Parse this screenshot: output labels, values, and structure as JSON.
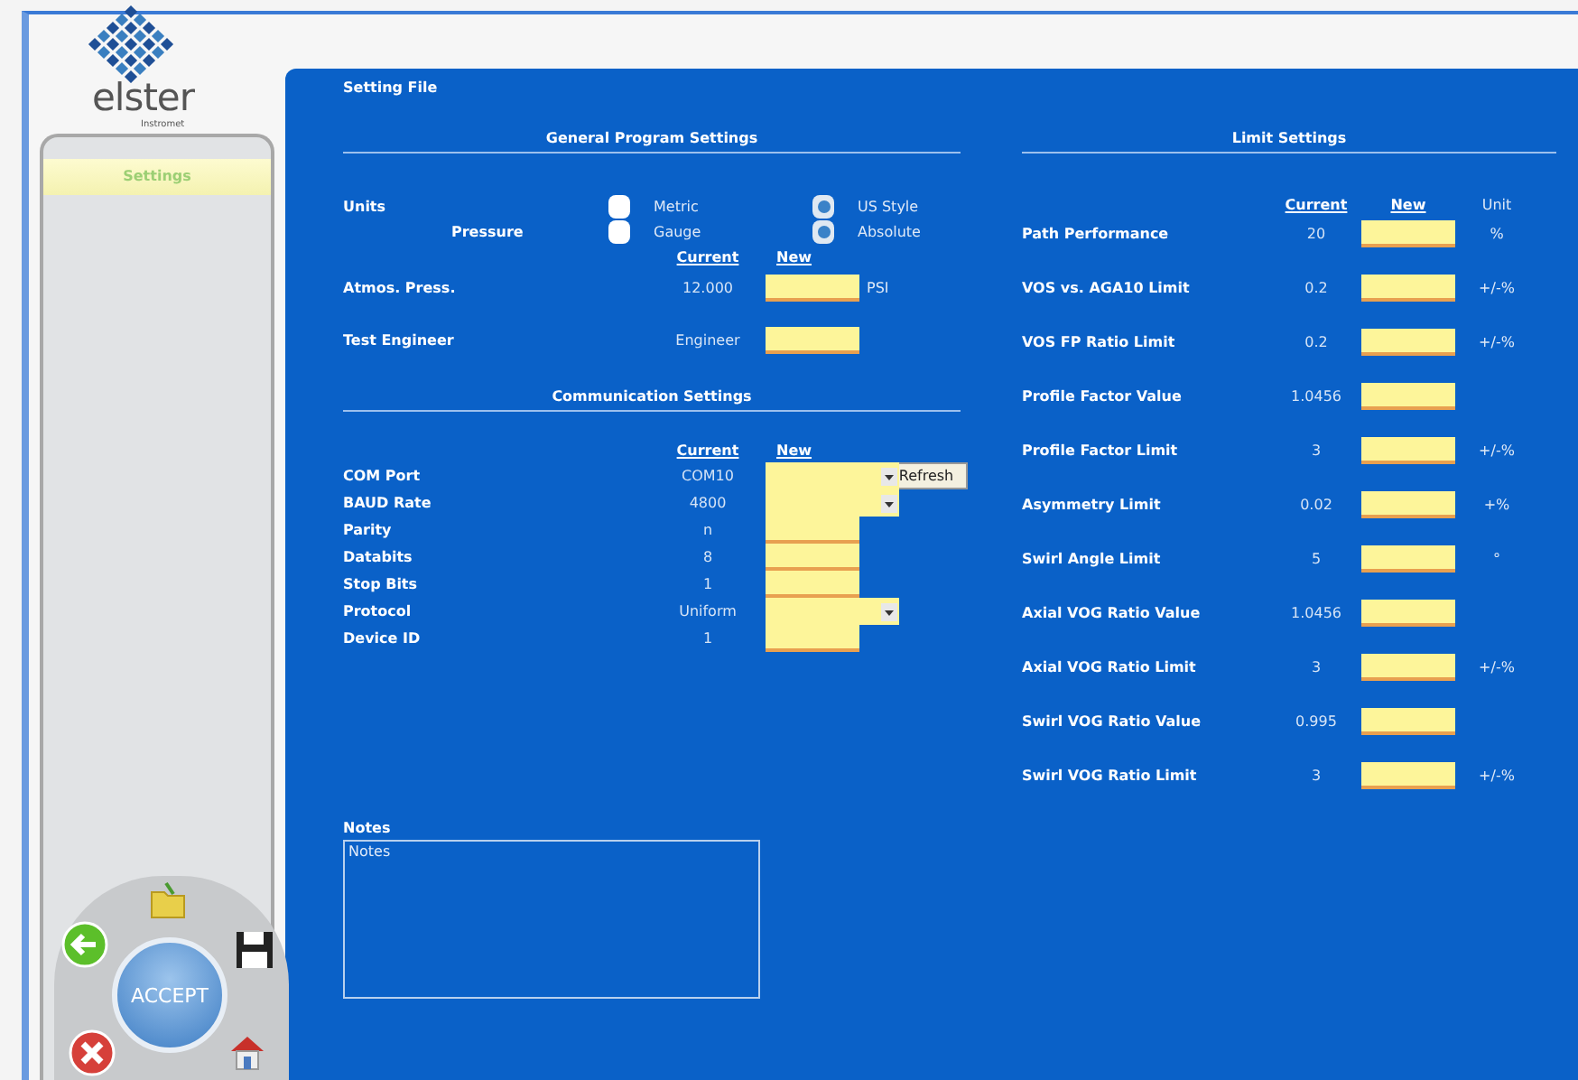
{
  "logo": {
    "name": "elster",
    "subtitle": "Instromet"
  },
  "sidebar": {
    "items": [
      {
        "label": "Settings",
        "selected": true
      }
    ]
  },
  "action_wheel": {
    "center": "ACCEPT"
  },
  "title": "Setting File",
  "general": {
    "title": "General Program Settings",
    "options": [
      {
        "label": "Units",
        "kind": "main",
        "choices": [
          {
            "label": "Metric",
            "selected": false
          },
          {
            "label": "US Style",
            "selected": true
          }
        ]
      },
      {
        "label": "Pressure",
        "kind": "sub",
        "choices": [
          {
            "label": "Gauge",
            "selected": false
          },
          {
            "label": "Absolute",
            "selected": true
          }
        ]
      }
    ],
    "columns": [
      "Current",
      "New"
    ],
    "fields": [
      {
        "label": "Atmos. Press.",
        "current": "12.000",
        "unit": "PSI"
      },
      {
        "label": "Test Engineer",
        "current": "Engineer"
      }
    ]
  },
  "communication": {
    "title": "Communication Settings",
    "columns": [
      "Current",
      "New"
    ],
    "rows": [
      {
        "label": "COM Port",
        "current": "COM10",
        "kind": "dropdown",
        "button": "Refresh"
      },
      {
        "label": "BAUD Rate",
        "current": "4800",
        "kind": "dropdown"
      },
      {
        "label": "Parity",
        "current": "n",
        "kind": "text"
      },
      {
        "label": "Databits",
        "current": "8",
        "kind": "text"
      },
      {
        "label": "Stop Bits",
        "current": "1",
        "kind": "text"
      },
      {
        "label": "Protocol",
        "current": "Uniform",
        "kind": "dropdown"
      },
      {
        "label": "Device ID",
        "current": "1",
        "kind": "text"
      }
    ]
  },
  "notes": {
    "label": "Notes",
    "value": "Notes"
  },
  "limits": {
    "title": "Limit Settings",
    "columns": [
      {
        "label": "Current",
        "kind": "underlined"
      },
      {
        "label": "New",
        "kind": "underlined"
      },
      {
        "label": "Unit",
        "kind": "plain"
      }
    ],
    "rows": [
      {
        "label": "Path Performance",
        "current": "20",
        "unit": "%"
      },
      {
        "label": "VOS vs. AGA10 Limit",
        "current": "0.2",
        "unit": "+/-%"
      },
      {
        "label": "VOS FP Ratio Limit",
        "current": "0.2",
        "unit": "+/-%"
      },
      {
        "label": "Profile Factor Value",
        "current": "1.0456"
      },
      {
        "label": "Profile Factor Limit",
        "current": "3",
        "unit": "+/-%"
      },
      {
        "label": "Asymmetry Limit",
        "current": "0.02",
        "unit": "+%"
      },
      {
        "label": "Swirl Angle Limit",
        "current": "5",
        "unit": "°"
      },
      {
        "label": "Axial VOG Ratio Value",
        "current": "1.0456"
      },
      {
        "label": "Axial VOG Ratio Limit",
        "current": "3",
        "unit": "+/-%"
      },
      {
        "label": "Swirl VOG Ratio Value",
        "current": "0.995"
      },
      {
        "label": "Swirl VOG Ratio Limit",
        "current": "3",
        "unit": "+/-%"
      }
    ]
  }
}
